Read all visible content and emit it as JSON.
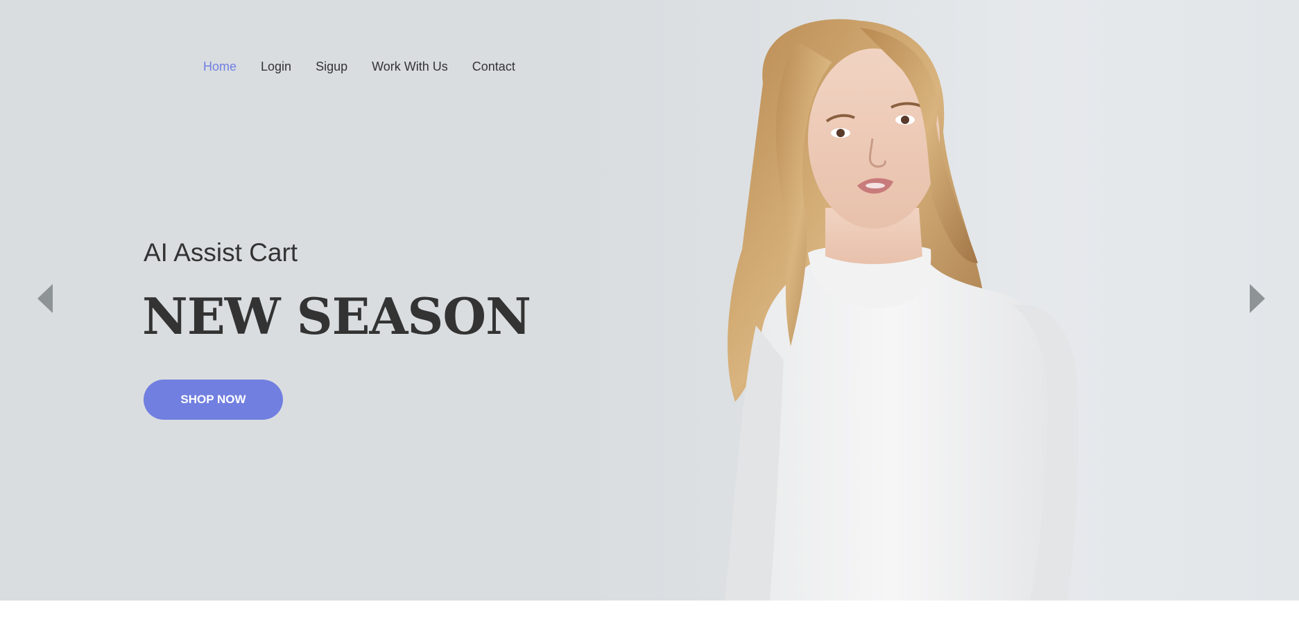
{
  "nav": {
    "items": [
      {
        "label": "Home",
        "active": true
      },
      {
        "label": "Login",
        "active": false
      },
      {
        "label": "Sigup",
        "active": false
      },
      {
        "label": "Work With Us",
        "active": false
      },
      {
        "label": "Contact",
        "active": false
      }
    ]
  },
  "hero": {
    "subtitle": "AI Assist Cart",
    "headline": "NEW SEASON",
    "cta_label": "SHOP NOW"
  },
  "slider": {
    "prev_icon": "triangle-left-icon",
    "next_icon": "triangle-right-icon"
  },
  "colors": {
    "accent": "#717fe0",
    "text": "#333333",
    "hero_bg": "#d9dde0",
    "arrow": "#8e9496"
  }
}
